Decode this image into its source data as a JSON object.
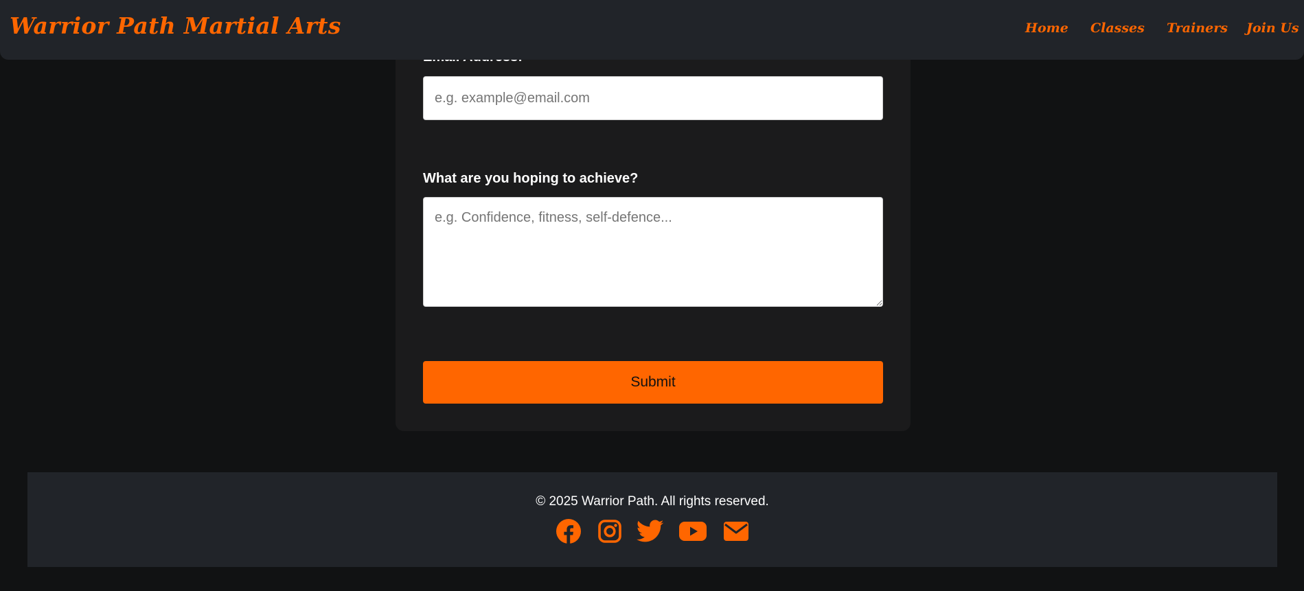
{
  "header": {
    "brand": "Warrior Path Martial Arts",
    "nav": {
      "home": "Home",
      "classes": "Classes",
      "trainers": "Trainers",
      "join": "Join Us"
    }
  },
  "form": {
    "email_label": "Email Address:",
    "email_placeholder": "e.g. example@email.com",
    "email_value": "",
    "goals_label": "What are you hoping to achieve?",
    "goals_placeholder": "e.g. Confidence, fitness, self-defence...",
    "goals_value": "",
    "submit_label": "Submit"
  },
  "footer": {
    "copyright": "© 2025 Warrior Path. All rights reserved.",
    "social_icons": [
      "facebook-icon",
      "instagram-icon",
      "twitter-icon",
      "youtube-icon",
      "email-icon"
    ]
  },
  "colors": {
    "accent": "#ff6600",
    "page_background": "#111213",
    "header_background": "#212429",
    "card_background": "#1b1b1c"
  }
}
